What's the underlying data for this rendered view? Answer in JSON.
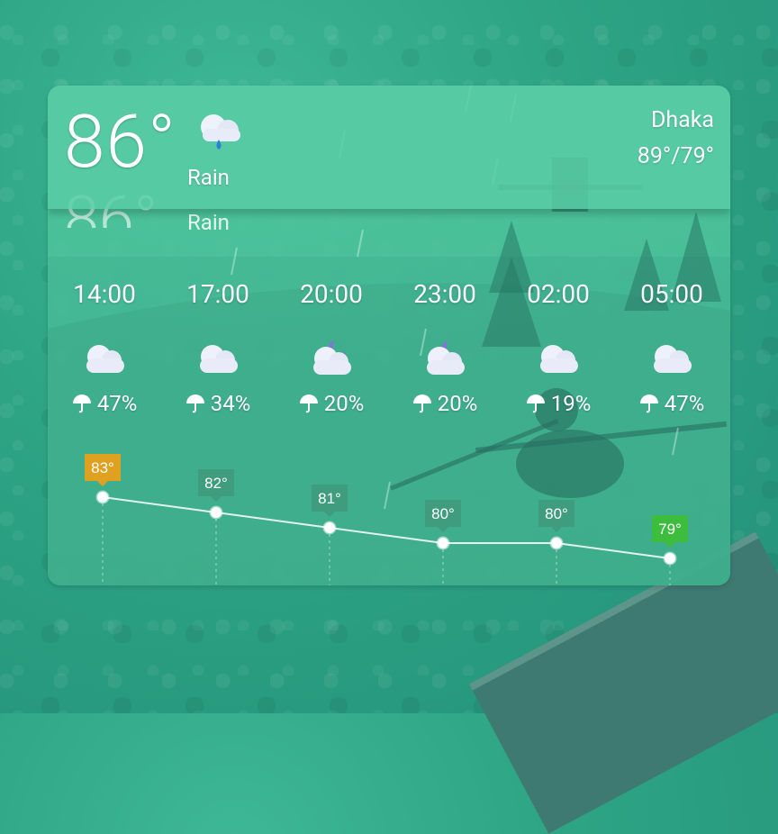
{
  "current": {
    "temperature": "86°",
    "condition": "Rain",
    "condition_icon": "rain-cloud-icon",
    "city": "Dhaka",
    "high_low": "89°/79°"
  },
  "colors": {
    "accent_warm": "#e0a020",
    "accent_cool": "#3dbd3d",
    "tag_default": "#3f9a7a",
    "card_bg": "#4ec49c"
  },
  "forecast": [
    {
      "time": "14:00",
      "icon": "cloudy-icon",
      "precip": "47%",
      "temp": "83°"
    },
    {
      "time": "17:00",
      "icon": "cloudy-icon",
      "precip": "34%",
      "temp": "82°"
    },
    {
      "time": "20:00",
      "icon": "partly-cloudy-night-icon",
      "precip": "20%",
      "temp": "81°"
    },
    {
      "time": "23:00",
      "icon": "partly-cloudy-night-icon",
      "precip": "20%",
      "temp": "80°"
    },
    {
      "time": "02:00",
      "icon": "cloudy-icon",
      "precip": "19%",
      "temp": "80°"
    },
    {
      "time": "05:00",
      "icon": "cloudy-icon",
      "precip": "47%",
      "temp": "79°"
    }
  ],
  "chart_data": {
    "type": "line",
    "categories": [
      "14:00",
      "17:00",
      "20:00",
      "23:00",
      "02:00",
      "05:00"
    ],
    "values": [
      83,
      82,
      81,
      80,
      80,
      79
    ],
    "labels": [
      "83°",
      "82°",
      "81°",
      "80°",
      "80°",
      "79°"
    ],
    "ylim": [
      78,
      84
    ]
  }
}
